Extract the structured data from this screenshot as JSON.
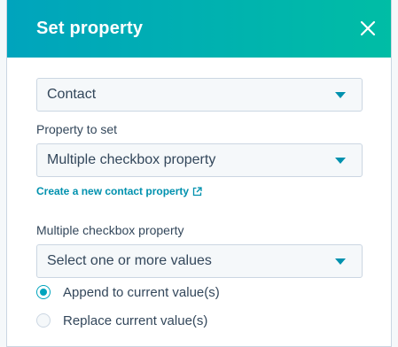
{
  "header": {
    "title": "Set property",
    "close_icon": "close-icon"
  },
  "object_select": {
    "value": "Contact"
  },
  "property_to_set": {
    "label": "Property to set",
    "value": "Multiple checkbox property"
  },
  "create_link": {
    "text": "Create a new contact property",
    "icon": "external-link-icon"
  },
  "values_field": {
    "label": "Multiple checkbox property",
    "placeholder": "Select one or more values"
  },
  "mode_options": [
    {
      "label": "Append to current value(s)",
      "selected": true
    },
    {
      "label": "Replace current value(s)",
      "selected": false
    }
  ],
  "colors": {
    "header_start": "#00a4bd",
    "header_end": "#00bda5",
    "accent": "#0091ae",
    "text": "#33475b"
  }
}
